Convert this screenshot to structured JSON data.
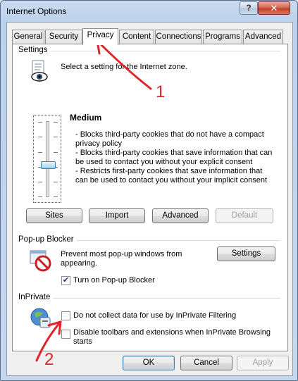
{
  "window": {
    "title": "Internet Options",
    "help_glyph": "?",
    "close_glyph": "✕"
  },
  "tabs": [
    {
      "label": "General",
      "active": false
    },
    {
      "label": "Security",
      "active": false
    },
    {
      "label": "Privacy",
      "active": true
    },
    {
      "label": "Content",
      "active": false
    },
    {
      "label": "Connections",
      "active": false
    },
    {
      "label": "Programs",
      "active": false
    },
    {
      "label": "Advanced",
      "active": false
    }
  ],
  "settings": {
    "group_label": "Settings",
    "instruction": "Select a setting for the Internet zone.",
    "level_title": "Medium",
    "bullets": [
      "- Blocks third-party cookies that do not have a compact",
      "privacy policy",
      "- Blocks third-party cookies that save information that can",
      "be used to contact you without your explicit consent",
      "- Restricts first-party cookies that save information that",
      "can be used to contact you without your implicit consent"
    ],
    "buttons": {
      "sites": "Sites",
      "import": "Import",
      "advanced": "Advanced",
      "default": "Default"
    }
  },
  "popup": {
    "group_label": "Pop-up Blocker",
    "description_line1": "Prevent most pop-up windows from",
    "description_line2": "appearing.",
    "settings_button": "Settings",
    "checkbox_label": "Turn on Pop-up Blocker",
    "checkbox_checked": true
  },
  "inprivate": {
    "group_label": "InPrivate",
    "filter_label": "Do not collect data for use by InPrivate Filtering",
    "filter_checked": false,
    "toolbars_label_line1": "Disable toolbars and extensions when InPrivate Browsing",
    "toolbars_label_line2": "starts",
    "toolbars_checked": false
  },
  "footer": {
    "ok": "OK",
    "cancel": "Cancel",
    "apply": "Apply"
  },
  "annotations": {
    "marker1": "1",
    "marker2": "2",
    "color": "#e0252a"
  }
}
